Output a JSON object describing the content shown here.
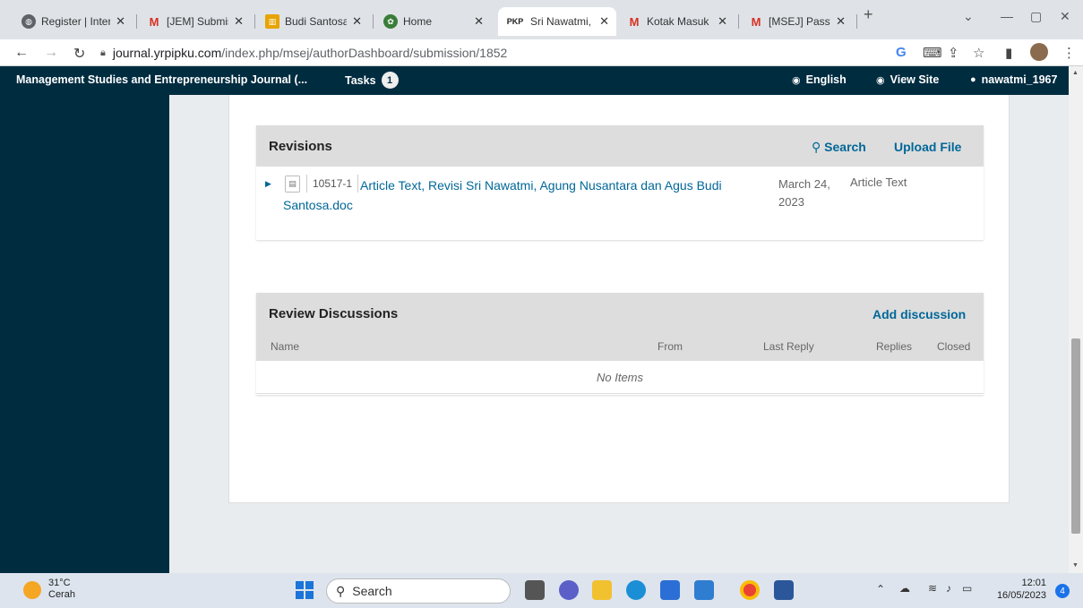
{
  "browser": {
    "tabs": [
      {
        "title": "Register | Inter",
        "favicon": "globe-icon",
        "color": "#555555"
      },
      {
        "title": "[JEM] Submissi",
        "favicon": "gmail-icon",
        "color": "#d93025"
      },
      {
        "title": "Budi Santosa",
        "favicon": "book-icon",
        "color": "#e8a400"
      },
      {
        "title": "Home",
        "favicon": "logo-icon",
        "color": "#3a7d3a"
      },
      {
        "title": "Sri Nawatmi, I",
        "favicon": "pkp-icon",
        "color": "#222222",
        "active": true
      },
      {
        "title": "Kotak Masuk (",
        "favicon": "gmail-icon",
        "color": "#d93025"
      },
      {
        "title": "[MSEJ] Passwo",
        "favicon": "gmail-icon",
        "color": "#d93025"
      }
    ],
    "new_tab": "+",
    "url_host": "journal.yrpipku.com",
    "url_path": "/index.php/msej/authorDashboard/submission/1852"
  },
  "app": {
    "journal_title": "Management Studies and Entrepreneurship Journal (...",
    "tasks_label": "Tasks",
    "tasks_count": "1",
    "language": "English",
    "view_site": "View Site",
    "user": "nawatmi_1967",
    "accent": "#006798",
    "header_bg": "#002c40"
  },
  "revisions": {
    "title": "Revisions",
    "search_label": "Search",
    "upload_label": "Upload File",
    "file": {
      "id": "10517-1",
      "name": "Article Text, Revisi Sri Nawatmi, Agung Nusantara dan Agus Budi Santosa.doc",
      "date": "March 24, 2023",
      "type": "Article Text"
    }
  },
  "discussions": {
    "title": "Review Discussions",
    "add_label": "Add discussion",
    "columns": [
      "Name",
      "From",
      "Last Reply",
      "Replies",
      "Closed"
    ],
    "empty": "No Items"
  },
  "taskbar": {
    "weather_temp": "31°C",
    "weather_desc": "Cerah",
    "search": "Search",
    "time": "12:01",
    "date": "16/05/2023",
    "notifications": "4"
  }
}
